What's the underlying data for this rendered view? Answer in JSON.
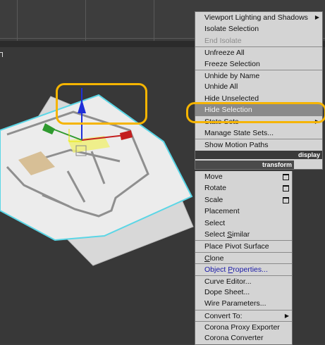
{
  "quad_menu": {
    "upper": [
      {
        "label": "Viewport Lighting and Shadows",
        "submenu": true
      },
      {
        "label": "Isolate Selection"
      },
      {
        "label": "End Isolate",
        "disabled": true
      },
      {
        "label": "Unfreeze All",
        "sep": true
      },
      {
        "label": "Freeze Selection"
      },
      {
        "label": "Unhide by Name",
        "sep": true
      },
      {
        "label": "Unhide All"
      },
      {
        "label": "Hide Unselected"
      },
      {
        "label": "Hide Selection",
        "selected": true
      },
      {
        "label": "State Sets",
        "submenu": true
      },
      {
        "label": "Manage State Sets..."
      },
      {
        "label": "Show Motion Paths",
        "sep": true
      }
    ],
    "display_header": "display",
    "transform_header": "transform",
    "lower": [
      {
        "label": "Move",
        "box": true
      },
      {
        "label": "Rotate",
        "box": true
      },
      {
        "label": "Scale",
        "box": true
      },
      {
        "label": "Placement"
      },
      {
        "label": "Select"
      },
      {
        "label": "Select Similar",
        "ul": "S"
      },
      {
        "label": "Place Pivot Surface",
        "sep": true
      },
      {
        "label": "Clone",
        "sep": true,
        "ul": "C"
      },
      {
        "label": "Object Properties...",
        "sep": true,
        "link": true,
        "ul": "P"
      },
      {
        "label": "Curve Editor...",
        "sep": true
      },
      {
        "label": "Dope Sheet..."
      },
      {
        "label": "Wire Parameters..."
      },
      {
        "label": "Convert To:",
        "sep": true,
        "submenu": true
      },
      {
        "label": "Corona Proxy Exporter",
        "sep": true
      },
      {
        "label": "Corona Converter"
      }
    ]
  },
  "colors": {
    "annotation": "#f5b400",
    "menu_bg": "#d4d4d4",
    "selected_bg": "#8a8a8a",
    "gizmo_z": "#1f2fd8",
    "gizmo_x": "#c41f1f",
    "gizmo_y": "#2f9a2f"
  }
}
